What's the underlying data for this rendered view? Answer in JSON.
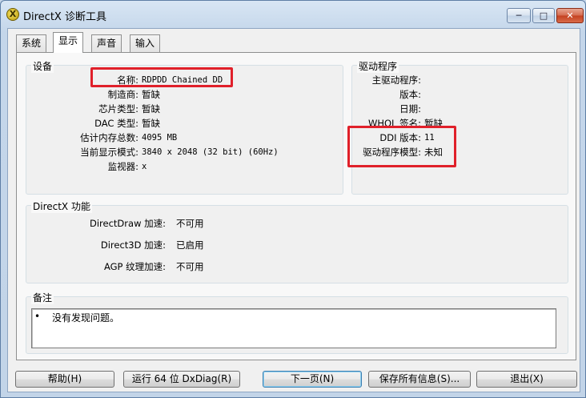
{
  "window": {
    "title": "DirectX 诊断工具",
    "controls": {
      "minimize": "─",
      "maximize": "□",
      "close": "✕"
    }
  },
  "tabs": [
    {
      "label": "系统",
      "active": false
    },
    {
      "label": "显示",
      "active": true
    },
    {
      "label": "声音",
      "active": false
    },
    {
      "label": "输入",
      "active": false
    }
  ],
  "device": {
    "title": "设备",
    "rows": [
      {
        "label": "名称:",
        "value": "RDPDD Chained DD"
      },
      {
        "label": "制造商:",
        "value": "暂缺"
      },
      {
        "label": "芯片类型:",
        "value": "暂缺"
      },
      {
        "label": "DAC 类型:",
        "value": "暂缺"
      },
      {
        "label": "估计内存总数:",
        "value": "4095 MB"
      },
      {
        "label": "当前显示模式:",
        "value": "3840 x 2048 (32 bit) (60Hz)"
      },
      {
        "label": "监视器:",
        "value": "x"
      }
    ]
  },
  "driver": {
    "title": "驱动程序",
    "rows": [
      {
        "label": "主驱动程序:",
        "value": ""
      },
      {
        "label": "版本:",
        "value": ""
      },
      {
        "label": "日期:",
        "value": ""
      },
      {
        "label": "WHQL 签名:",
        "value": "暂缺"
      },
      {
        "label": "DDI 版本:",
        "value": "11"
      },
      {
        "label": "驱动程序模型:",
        "value": "未知"
      }
    ]
  },
  "directx": {
    "title": "DirectX 功能",
    "rows": [
      {
        "label": "DirectDraw 加速:",
        "value": "不可用"
      },
      {
        "label": "Direct3D 加速:",
        "value": "已启用"
      },
      {
        "label": "AGP 纹理加速:",
        "value": "不可用"
      }
    ]
  },
  "notes": {
    "title": "备注",
    "bullet": "•",
    "items": [
      "没有发现问题。"
    ]
  },
  "buttons": {
    "help": "帮助(H)",
    "run64": "运行 64 位 DxDiag(R)",
    "next": "下一页(N)",
    "save": "保存所有信息(S)...",
    "exit": "退出(X)"
  },
  "colors": {
    "highlight_box": "#e0202a",
    "window_frame": "#c4d6ea"
  }
}
